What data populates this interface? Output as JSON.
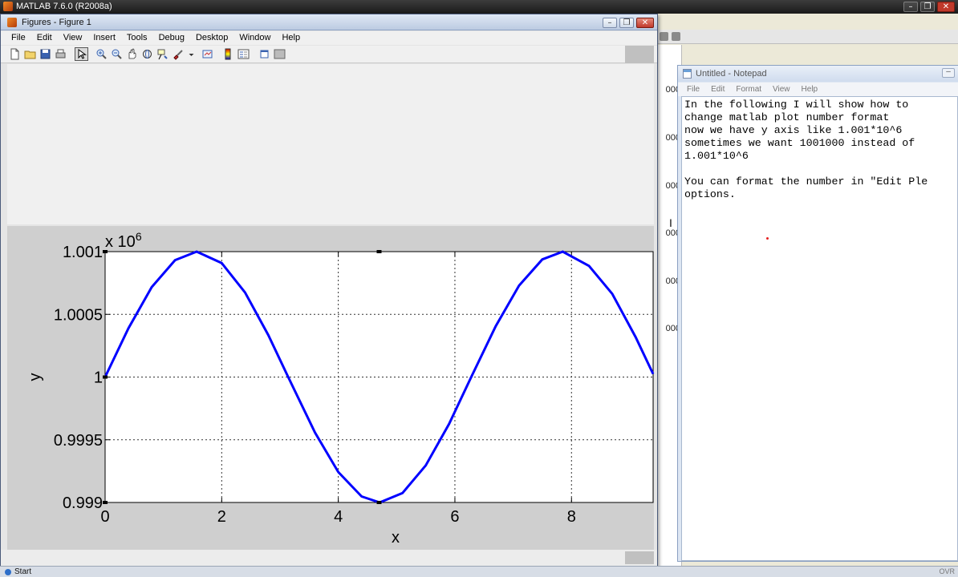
{
  "matlab": {
    "title": "MATLAB 7.6.0 (R2008a)",
    "workspace_values": [
      "000",
      "000",
      "000",
      "000",
      "000",
      "000"
    ]
  },
  "figure_window": {
    "title": "Figures - Figure 1",
    "menu": [
      "File",
      "Edit",
      "View",
      "Insert",
      "Tools",
      "Debug",
      "Desktop",
      "Window",
      "Help"
    ],
    "toolbar_icons": [
      "new-figure-icon",
      "open-file-icon",
      "save-icon",
      "print-icon",
      "edit-plot-arrow-icon",
      "zoom-in-icon",
      "zoom-out-icon",
      "pan-hand-icon",
      "rotate-3d-icon",
      "data-cursor-icon",
      "brush-icon",
      "link-plot-icon",
      "insert-colorbar-icon",
      "insert-legend-icon",
      "hide-plot-tools-icon",
      "show-plot-tools-icon"
    ]
  },
  "notepad": {
    "title": "Untitled - Notepad",
    "menu": [
      "File",
      "Edit",
      "Format",
      "View",
      "Help"
    ],
    "text": "In the following I will show how to\nchange matlab plot number format\nnow we have y axis like 1.001*10^6\nsometimes we want 1001000 instead of\n1.001*10^6\n\nYou can format the number in \"Edit Ple\noptions."
  },
  "taskbar": {
    "start_label": "Start",
    "indicator": "OVR"
  },
  "chart_data": {
    "type": "line",
    "title": "",
    "xlabel": "x",
    "ylabel": "y",
    "exponent_label": "x 10",
    "exponent_power": "6",
    "xlim": [
      0,
      9.4
    ],
    "ylim": [
      999000,
      1001000
    ],
    "x_ticks": [
      0,
      2,
      4,
      6,
      8
    ],
    "x_tick_labels": [
      "0",
      "2",
      "4",
      "6",
      "8"
    ],
    "y_ticks": [
      999000,
      999500,
      1000000,
      1000500,
      1001000
    ],
    "y_tick_labels": [
      "0.999",
      "0.9995",
      "1",
      "1.0005",
      "1.001"
    ],
    "grid": true,
    "series": [
      {
        "color": "#0000ff",
        "function": "1000000 + 1000*sin(x)",
        "x": [
          0,
          0.4,
          0.8,
          1.2,
          1.57,
          2.0,
          2.4,
          2.8,
          3.14,
          3.6,
          4.0,
          4.4,
          4.71,
          5.1,
          5.5,
          5.9,
          6.28,
          6.7,
          7.1,
          7.5,
          7.85,
          8.3,
          8.7,
          9.1,
          9.4
        ],
        "y": [
          1000000,
          1000389,
          1000717,
          1000932,
          1001000,
          1000909,
          1000675,
          1000335,
          1000000,
          999557,
          999243,
          999048,
          999000,
          999075,
          999295,
          999626,
          1000000,
          1000405,
          1000729,
          1000938,
          1001000,
          1000886,
          1000663,
          1000319,
          1000025
        ]
      }
    ]
  }
}
